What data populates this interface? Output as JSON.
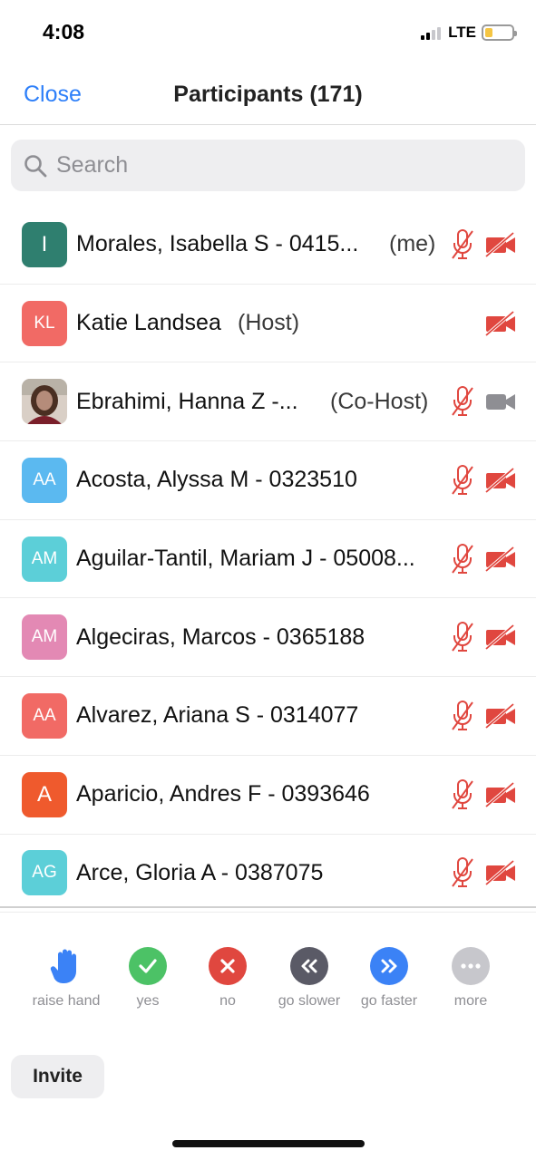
{
  "status_bar": {
    "time": "4:08",
    "network": "LTE",
    "battery_level": 0.3,
    "battery_color": "#f5c542",
    "signal_bars_filled": 2
  },
  "nav": {
    "close_label": "Close",
    "title": "Participants (171)"
  },
  "search": {
    "placeholder": "Search"
  },
  "participants": [
    {
      "name": "Morales, Isabella S - 0415...",
      "role": "(me)",
      "avatar_text": "I",
      "avatar_color": "#2f7f6f",
      "mic": "muted",
      "video": "off"
    },
    {
      "name": "Katie Landsea",
      "role": "(Host)",
      "avatar_text": "KL",
      "avatar_color": "#f16a65",
      "mic": "none",
      "video": "off"
    },
    {
      "name": "Ebrahimi, Hanna Z -...",
      "role": "(Co-Host)",
      "avatar_text": "",
      "avatar_color": "#b58c7a",
      "avatar_photo": true,
      "mic": "muted",
      "video": "on"
    },
    {
      "name": "Acosta, Alyssa M - 0323510",
      "role": "",
      "avatar_text": "AA",
      "avatar_color": "#5bb9f0",
      "mic": "muted",
      "video": "off"
    },
    {
      "name": "Aguilar-Tantil, Mariam J - 05008...",
      "role": "",
      "avatar_text": "AM",
      "avatar_color": "#5ccfd8",
      "mic": "muted",
      "video": "off"
    },
    {
      "name": "Algeciras, Marcos - 0365188",
      "role": "",
      "avatar_text": "AM",
      "avatar_color": "#e389b4",
      "mic": "muted",
      "video": "off"
    },
    {
      "name": "Alvarez, Ariana S - 0314077",
      "role": "",
      "avatar_text": "AA",
      "avatar_color": "#f16a65",
      "mic": "muted",
      "video": "off"
    },
    {
      "name": "Aparicio, Andres F - 0393646",
      "role": "",
      "avatar_text": "A",
      "avatar_color": "#ef5a2d",
      "mic": "muted",
      "video": "off"
    },
    {
      "name": "Arce, Gloria A - 0387075",
      "role": "",
      "avatar_text": "AG",
      "avatar_color": "#5ccfd8",
      "mic": "muted",
      "video": "off"
    }
  ],
  "reactions": [
    {
      "label": "raise hand",
      "icon": "raise-hand-icon",
      "color": "#3b82f6"
    },
    {
      "label": "yes",
      "icon": "checkmark-icon",
      "color": "#4cc266"
    },
    {
      "label": "no",
      "icon": "x-icon",
      "color": "#e0473f"
    },
    {
      "label": "go slower",
      "icon": "rewind-icon",
      "color": "#5a5a66"
    },
    {
      "label": "go faster",
      "icon": "fast-forward-icon",
      "color": "#3b82f6"
    },
    {
      "label": "more",
      "icon": "more-icon",
      "color": "#c7c7cc"
    }
  ],
  "invite_label": "Invite",
  "colors": {
    "accent": "#2d7ff9",
    "muted_red": "#e0473f",
    "video_on_gray": "#8e8e93"
  }
}
